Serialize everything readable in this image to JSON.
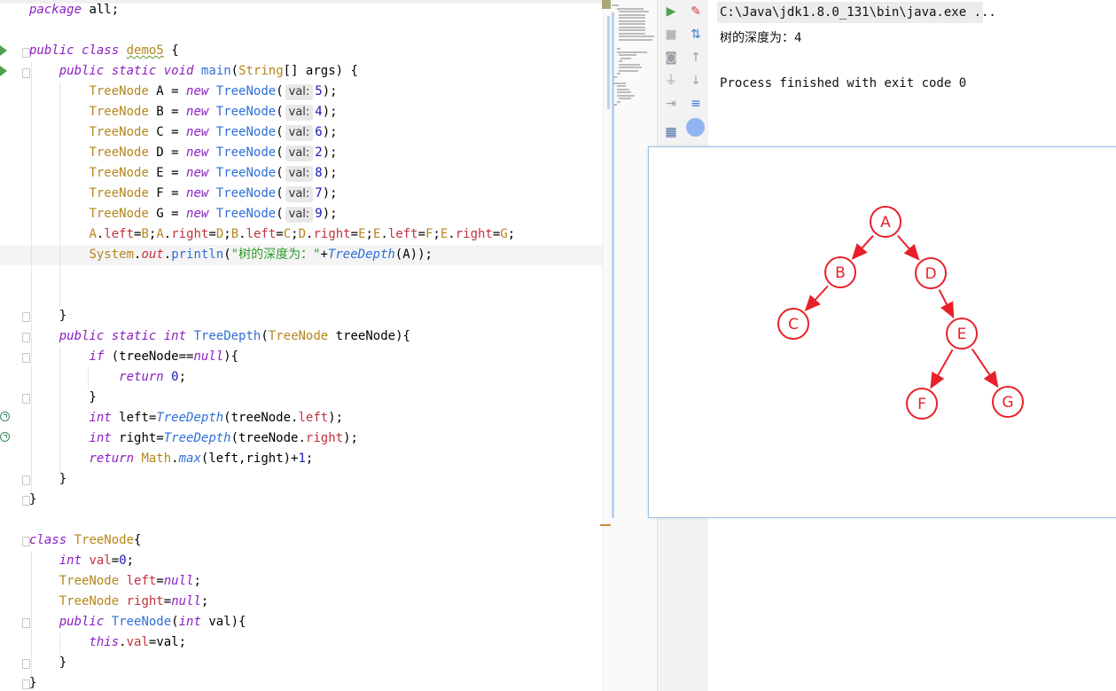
{
  "editor": {
    "lines": [
      {
        "segs": [
          [
            "k",
            "package"
          ],
          [
            "p",
            " "
          ],
          [
            "p",
            "all;"
          ]
        ]
      },
      {
        "segs": []
      },
      {
        "segs": [
          [
            "k",
            "public"
          ],
          [
            "p",
            " "
          ],
          [
            "k",
            "class"
          ],
          [
            "p",
            " "
          ],
          [
            "tu",
            "demo5"
          ],
          [
            "p",
            " {"
          ]
        ]
      },
      {
        "segs": [
          [
            "p",
            "    "
          ],
          [
            "k",
            "public"
          ],
          [
            "p",
            " "
          ],
          [
            "k",
            "static"
          ],
          [
            "p",
            " "
          ],
          [
            "k",
            "void"
          ],
          [
            "p",
            " "
          ],
          [
            "f",
            "main"
          ],
          [
            "p",
            "("
          ],
          [
            "t",
            "String"
          ],
          [
            "p",
            "[] args) {"
          ]
        ]
      },
      {
        "segs": [
          [
            "p",
            "        "
          ],
          [
            "t",
            "TreeNode"
          ],
          [
            "p",
            " A = "
          ],
          [
            "k",
            "new"
          ],
          [
            "p",
            " "
          ],
          [
            "f",
            "TreeNode"
          ],
          [
            "p",
            "("
          ],
          [
            "h",
            "val:"
          ],
          [
            "n",
            "5"
          ],
          [
            "p",
            ");"
          ]
        ]
      },
      {
        "segs": [
          [
            "p",
            "        "
          ],
          [
            "t",
            "TreeNode"
          ],
          [
            "p",
            " B = "
          ],
          [
            "k",
            "new"
          ],
          [
            "p",
            " "
          ],
          [
            "f",
            "TreeNode"
          ],
          [
            "p",
            "("
          ],
          [
            "h",
            "val:"
          ],
          [
            "n",
            "4"
          ],
          [
            "p",
            ");"
          ]
        ]
      },
      {
        "segs": [
          [
            "p",
            "        "
          ],
          [
            "t",
            "TreeNode"
          ],
          [
            "p",
            " C = "
          ],
          [
            "k",
            "new"
          ],
          [
            "p",
            " "
          ],
          [
            "f",
            "TreeNode"
          ],
          [
            "p",
            "("
          ],
          [
            "h",
            "val:"
          ],
          [
            "n",
            "6"
          ],
          [
            "p",
            ");"
          ]
        ]
      },
      {
        "segs": [
          [
            "p",
            "        "
          ],
          [
            "t",
            "TreeNode"
          ],
          [
            "p",
            " D = "
          ],
          [
            "k",
            "new"
          ],
          [
            "p",
            " "
          ],
          [
            "f",
            "TreeNode"
          ],
          [
            "p",
            "("
          ],
          [
            "h",
            "val:"
          ],
          [
            "n",
            "2"
          ],
          [
            "p",
            ");"
          ]
        ]
      },
      {
        "segs": [
          [
            "p",
            "        "
          ],
          [
            "t",
            "TreeNode"
          ],
          [
            "p",
            " E = "
          ],
          [
            "k",
            "new"
          ],
          [
            "p",
            " "
          ],
          [
            "f",
            "TreeNode"
          ],
          [
            "p",
            "("
          ],
          [
            "h",
            "val:"
          ],
          [
            "n",
            "8"
          ],
          [
            "p",
            ");"
          ]
        ]
      },
      {
        "segs": [
          [
            "p",
            "        "
          ],
          [
            "t",
            "TreeNode"
          ],
          [
            "p",
            " F = "
          ],
          [
            "k",
            "new"
          ],
          [
            "p",
            " "
          ],
          [
            "f",
            "TreeNode"
          ],
          [
            "p",
            "("
          ],
          [
            "h",
            "val:"
          ],
          [
            "n",
            "7"
          ],
          [
            "p",
            ");"
          ]
        ]
      },
      {
        "segs": [
          [
            "p",
            "        "
          ],
          [
            "t",
            "TreeNode"
          ],
          [
            "p",
            " G = "
          ],
          [
            "k",
            "new"
          ],
          [
            "p",
            " "
          ],
          [
            "f",
            "TreeNode"
          ],
          [
            "p",
            "("
          ],
          [
            "h",
            "val:"
          ],
          [
            "n",
            "9"
          ],
          [
            "p",
            ");"
          ]
        ]
      },
      {
        "segs": [
          [
            "p",
            "        "
          ],
          [
            "t",
            "A"
          ],
          [
            "p",
            "."
          ],
          [
            "fld",
            "left"
          ],
          [
            "p",
            "="
          ],
          [
            "t",
            "B"
          ],
          [
            "p",
            ";"
          ],
          [
            "t",
            "A"
          ],
          [
            "p",
            "."
          ],
          [
            "fld",
            "right"
          ],
          [
            "p",
            "="
          ],
          [
            "t",
            "D"
          ],
          [
            "p",
            ";"
          ],
          [
            "t",
            "B"
          ],
          [
            "p",
            "."
          ],
          [
            "fld",
            "left"
          ],
          [
            "p",
            "="
          ],
          [
            "t",
            "C"
          ],
          [
            "p",
            ";"
          ],
          [
            "t",
            "D"
          ],
          [
            "p",
            "."
          ],
          [
            "fld",
            "right"
          ],
          [
            "p",
            "="
          ],
          [
            "t",
            "E"
          ],
          [
            "p",
            ";"
          ],
          [
            "t",
            "E"
          ],
          [
            "p",
            "."
          ],
          [
            "fld",
            "left"
          ],
          [
            "p",
            "="
          ],
          [
            "t",
            "F"
          ],
          [
            "p",
            ";"
          ],
          [
            "t",
            "E"
          ],
          [
            "p",
            "."
          ],
          [
            "fld",
            "right"
          ],
          [
            "p",
            "="
          ],
          [
            "t",
            "G"
          ],
          [
            "p",
            ";"
          ]
        ]
      },
      {
        "segs": [
          [
            "p",
            "        "
          ],
          [
            "t",
            "System"
          ],
          [
            "p",
            "."
          ],
          [
            "fldi",
            "out"
          ],
          [
            "p",
            "."
          ],
          [
            "f",
            "println"
          ],
          [
            "p",
            "("
          ],
          [
            "s",
            "\"树的深度为：\""
          ],
          [
            "p",
            "+"
          ],
          [
            "fi",
            "TreeDepth"
          ],
          [
            "p",
            "(A));"
          ]
        ],
        "cur": true
      },
      {
        "segs": []
      },
      {
        "segs": []
      },
      {
        "segs": [
          [
            "p",
            "    }"
          ]
        ]
      },
      {
        "segs": [
          [
            "p",
            "    "
          ],
          [
            "k",
            "public"
          ],
          [
            "p",
            " "
          ],
          [
            "k",
            "static"
          ],
          [
            "p",
            " "
          ],
          [
            "k",
            "int"
          ],
          [
            "p",
            " "
          ],
          [
            "f",
            "TreeDepth"
          ],
          [
            "p",
            "("
          ],
          [
            "t",
            "TreeNode"
          ],
          [
            "p",
            " treeNode){"
          ]
        ]
      },
      {
        "segs": [
          [
            "p",
            "        "
          ],
          [
            "k",
            "if"
          ],
          [
            "p",
            " (treeNode=="
          ],
          [
            "k",
            "null"
          ],
          [
            "p",
            "){"
          ]
        ]
      },
      {
        "segs": [
          [
            "p",
            "            "
          ],
          [
            "k",
            "return"
          ],
          [
            "p",
            " "
          ],
          [
            "n",
            "0"
          ],
          [
            "p",
            ";"
          ]
        ]
      },
      {
        "segs": [
          [
            "p",
            "        }"
          ]
        ]
      },
      {
        "segs": [
          [
            "p",
            "        "
          ],
          [
            "k",
            "int"
          ],
          [
            "p",
            " left="
          ],
          [
            "fi",
            "TreeDepth"
          ],
          [
            "p",
            "(treeNode."
          ],
          [
            "fld",
            "left"
          ],
          [
            "p",
            ");"
          ]
        ]
      },
      {
        "segs": [
          [
            "p",
            "        "
          ],
          [
            "k",
            "int"
          ],
          [
            "p",
            " right="
          ],
          [
            "fi",
            "TreeDepth"
          ],
          [
            "p",
            "(treeNode."
          ],
          [
            "fld",
            "right"
          ],
          [
            "p",
            ");"
          ]
        ]
      },
      {
        "segs": [
          [
            "p",
            "        "
          ],
          [
            "k",
            "return"
          ],
          [
            "p",
            " "
          ],
          [
            "t",
            "Math"
          ],
          [
            "p",
            "."
          ],
          [
            "fi",
            "max"
          ],
          [
            "p",
            "(left,right)+"
          ],
          [
            "n",
            "1"
          ],
          [
            "p",
            ";"
          ]
        ]
      },
      {
        "segs": [
          [
            "p",
            "    }"
          ]
        ]
      },
      {
        "segs": [
          [
            "p",
            "}"
          ]
        ]
      },
      {
        "segs": []
      },
      {
        "segs": [
          [
            "k",
            "class"
          ],
          [
            "p",
            " "
          ],
          [
            "t",
            "TreeNode"
          ],
          [
            "p",
            "{"
          ]
        ]
      },
      {
        "segs": [
          [
            "p",
            "    "
          ],
          [
            "k",
            "int"
          ],
          [
            "p",
            " "
          ],
          [
            "fld",
            "val"
          ],
          [
            "p",
            "="
          ],
          [
            "n",
            "0"
          ],
          [
            "p",
            ";"
          ]
        ]
      },
      {
        "segs": [
          [
            "p",
            "    "
          ],
          [
            "t",
            "TreeNode"
          ],
          [
            "p",
            " "
          ],
          [
            "fld",
            "left"
          ],
          [
            "p",
            "="
          ],
          [
            "k",
            "null"
          ],
          [
            "p",
            ";"
          ]
        ]
      },
      {
        "segs": [
          [
            "p",
            "    "
          ],
          [
            "t",
            "TreeNode"
          ],
          [
            "p",
            " "
          ],
          [
            "fld",
            "right"
          ],
          [
            "p",
            "="
          ],
          [
            "k",
            "null"
          ],
          [
            "p",
            ";"
          ]
        ]
      },
      {
        "segs": [
          [
            "p",
            "    "
          ],
          [
            "k",
            "public"
          ],
          [
            "p",
            " "
          ],
          [
            "f",
            "TreeNode"
          ],
          [
            "p",
            "("
          ],
          [
            "k",
            "int"
          ],
          [
            "p",
            " val){"
          ]
        ]
      },
      {
        "segs": [
          [
            "p",
            "        "
          ],
          [
            "k",
            "this"
          ],
          [
            "p",
            "."
          ],
          [
            "fld",
            "val"
          ],
          [
            "p",
            "=val;"
          ]
        ]
      },
      {
        "segs": [
          [
            "p",
            "    }"
          ]
        ]
      },
      {
        "segs": [
          [
            "p",
            "}"
          ]
        ]
      }
    ]
  },
  "console": {
    "command": "C:\\Java\\jdk1.8.0_131\\bin\\java.exe ...",
    "output": "树的深度为：4",
    "exit": "Process finished with exit code 0"
  },
  "tree": {
    "color": "#e8202a",
    "nodes": [
      {
        "id": "A",
        "label": "A"
      },
      {
        "id": "B",
        "label": "B"
      },
      {
        "id": "C",
        "label": "C"
      },
      {
        "id": "D",
        "label": "D"
      },
      {
        "id": "E",
        "label": "E"
      },
      {
        "id": "F",
        "label": "F"
      },
      {
        "id": "G",
        "label": "G"
      }
    ],
    "edges": [
      [
        "A",
        "B"
      ],
      [
        "A",
        "D"
      ],
      [
        "B",
        "C"
      ],
      [
        "D",
        "E"
      ],
      [
        "E",
        "F"
      ],
      [
        "E",
        "G"
      ]
    ]
  },
  "toolbar": {
    "icons": [
      "rerun-icon",
      "stop-icon",
      "camera-icon",
      "plug-icon",
      "exit-icon",
      "layout-icon",
      "clear-icon",
      "sort-icon",
      "up-arrow-icon",
      "down-arrow-icon",
      "soft-wrap-icon",
      "settings-circle-icon"
    ]
  }
}
